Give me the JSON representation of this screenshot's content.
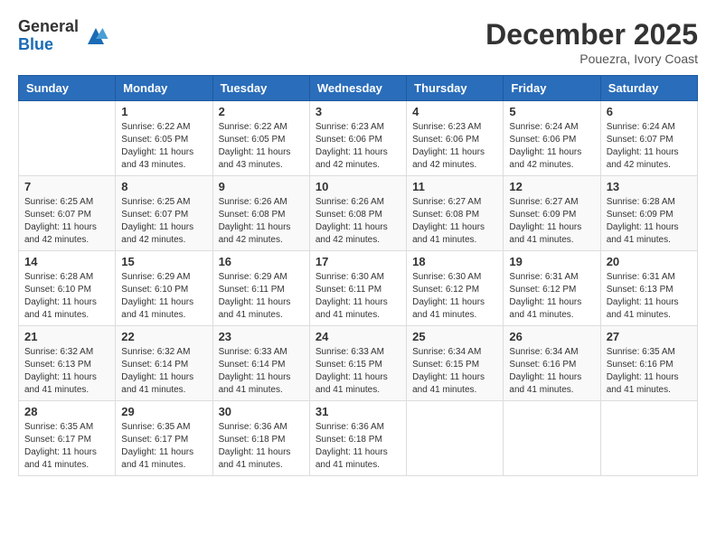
{
  "logo": {
    "general": "General",
    "blue": "Blue"
  },
  "header": {
    "month": "December 2025",
    "location": "Pouezra, Ivory Coast"
  },
  "days_of_week": [
    "Sunday",
    "Monday",
    "Tuesday",
    "Wednesday",
    "Thursday",
    "Friday",
    "Saturday"
  ],
  "weeks": [
    [
      {
        "day": "",
        "sunrise": "",
        "sunset": "",
        "daylight": ""
      },
      {
        "day": "1",
        "sunrise": "Sunrise: 6:22 AM",
        "sunset": "Sunset: 6:05 PM",
        "daylight": "Daylight: 11 hours and 43 minutes."
      },
      {
        "day": "2",
        "sunrise": "Sunrise: 6:22 AM",
        "sunset": "Sunset: 6:05 PM",
        "daylight": "Daylight: 11 hours and 43 minutes."
      },
      {
        "day": "3",
        "sunrise": "Sunrise: 6:23 AM",
        "sunset": "Sunset: 6:06 PM",
        "daylight": "Daylight: 11 hours and 42 minutes."
      },
      {
        "day": "4",
        "sunrise": "Sunrise: 6:23 AM",
        "sunset": "Sunset: 6:06 PM",
        "daylight": "Daylight: 11 hours and 42 minutes."
      },
      {
        "day": "5",
        "sunrise": "Sunrise: 6:24 AM",
        "sunset": "Sunset: 6:06 PM",
        "daylight": "Daylight: 11 hours and 42 minutes."
      },
      {
        "day": "6",
        "sunrise": "Sunrise: 6:24 AM",
        "sunset": "Sunset: 6:07 PM",
        "daylight": "Daylight: 11 hours and 42 minutes."
      }
    ],
    [
      {
        "day": "7",
        "sunrise": "Sunrise: 6:25 AM",
        "sunset": "Sunset: 6:07 PM",
        "daylight": "Daylight: 11 hours and 42 minutes."
      },
      {
        "day": "8",
        "sunrise": "Sunrise: 6:25 AM",
        "sunset": "Sunset: 6:07 PM",
        "daylight": "Daylight: 11 hours and 42 minutes."
      },
      {
        "day": "9",
        "sunrise": "Sunrise: 6:26 AM",
        "sunset": "Sunset: 6:08 PM",
        "daylight": "Daylight: 11 hours and 42 minutes."
      },
      {
        "day": "10",
        "sunrise": "Sunrise: 6:26 AM",
        "sunset": "Sunset: 6:08 PM",
        "daylight": "Daylight: 11 hours and 42 minutes."
      },
      {
        "day": "11",
        "sunrise": "Sunrise: 6:27 AM",
        "sunset": "Sunset: 6:08 PM",
        "daylight": "Daylight: 11 hours and 41 minutes."
      },
      {
        "day": "12",
        "sunrise": "Sunrise: 6:27 AM",
        "sunset": "Sunset: 6:09 PM",
        "daylight": "Daylight: 11 hours and 41 minutes."
      },
      {
        "day": "13",
        "sunrise": "Sunrise: 6:28 AM",
        "sunset": "Sunset: 6:09 PM",
        "daylight": "Daylight: 11 hours and 41 minutes."
      }
    ],
    [
      {
        "day": "14",
        "sunrise": "Sunrise: 6:28 AM",
        "sunset": "Sunset: 6:10 PM",
        "daylight": "Daylight: 11 hours and 41 minutes."
      },
      {
        "day": "15",
        "sunrise": "Sunrise: 6:29 AM",
        "sunset": "Sunset: 6:10 PM",
        "daylight": "Daylight: 11 hours and 41 minutes."
      },
      {
        "day": "16",
        "sunrise": "Sunrise: 6:29 AM",
        "sunset": "Sunset: 6:11 PM",
        "daylight": "Daylight: 11 hours and 41 minutes."
      },
      {
        "day": "17",
        "sunrise": "Sunrise: 6:30 AM",
        "sunset": "Sunset: 6:11 PM",
        "daylight": "Daylight: 11 hours and 41 minutes."
      },
      {
        "day": "18",
        "sunrise": "Sunrise: 6:30 AM",
        "sunset": "Sunset: 6:12 PM",
        "daylight": "Daylight: 11 hours and 41 minutes."
      },
      {
        "day": "19",
        "sunrise": "Sunrise: 6:31 AM",
        "sunset": "Sunset: 6:12 PM",
        "daylight": "Daylight: 11 hours and 41 minutes."
      },
      {
        "day": "20",
        "sunrise": "Sunrise: 6:31 AM",
        "sunset": "Sunset: 6:13 PM",
        "daylight": "Daylight: 11 hours and 41 minutes."
      }
    ],
    [
      {
        "day": "21",
        "sunrise": "Sunrise: 6:32 AM",
        "sunset": "Sunset: 6:13 PM",
        "daylight": "Daylight: 11 hours and 41 minutes."
      },
      {
        "day": "22",
        "sunrise": "Sunrise: 6:32 AM",
        "sunset": "Sunset: 6:14 PM",
        "daylight": "Daylight: 11 hours and 41 minutes."
      },
      {
        "day": "23",
        "sunrise": "Sunrise: 6:33 AM",
        "sunset": "Sunset: 6:14 PM",
        "daylight": "Daylight: 11 hours and 41 minutes."
      },
      {
        "day": "24",
        "sunrise": "Sunrise: 6:33 AM",
        "sunset": "Sunset: 6:15 PM",
        "daylight": "Daylight: 11 hours and 41 minutes."
      },
      {
        "day": "25",
        "sunrise": "Sunrise: 6:34 AM",
        "sunset": "Sunset: 6:15 PM",
        "daylight": "Daylight: 11 hours and 41 minutes."
      },
      {
        "day": "26",
        "sunrise": "Sunrise: 6:34 AM",
        "sunset": "Sunset: 6:16 PM",
        "daylight": "Daylight: 11 hours and 41 minutes."
      },
      {
        "day": "27",
        "sunrise": "Sunrise: 6:35 AM",
        "sunset": "Sunset: 6:16 PM",
        "daylight": "Daylight: 11 hours and 41 minutes."
      }
    ],
    [
      {
        "day": "28",
        "sunrise": "Sunrise: 6:35 AM",
        "sunset": "Sunset: 6:17 PM",
        "daylight": "Daylight: 11 hours and 41 minutes."
      },
      {
        "day": "29",
        "sunrise": "Sunrise: 6:35 AM",
        "sunset": "Sunset: 6:17 PM",
        "daylight": "Daylight: 11 hours and 41 minutes."
      },
      {
        "day": "30",
        "sunrise": "Sunrise: 6:36 AM",
        "sunset": "Sunset: 6:18 PM",
        "daylight": "Daylight: 11 hours and 41 minutes."
      },
      {
        "day": "31",
        "sunrise": "Sunrise: 6:36 AM",
        "sunset": "Sunset: 6:18 PM",
        "daylight": "Daylight: 11 hours and 41 minutes."
      },
      {
        "day": "",
        "sunrise": "",
        "sunset": "",
        "daylight": ""
      },
      {
        "day": "",
        "sunrise": "",
        "sunset": "",
        "daylight": ""
      },
      {
        "day": "",
        "sunrise": "",
        "sunset": "",
        "daylight": ""
      }
    ]
  ]
}
